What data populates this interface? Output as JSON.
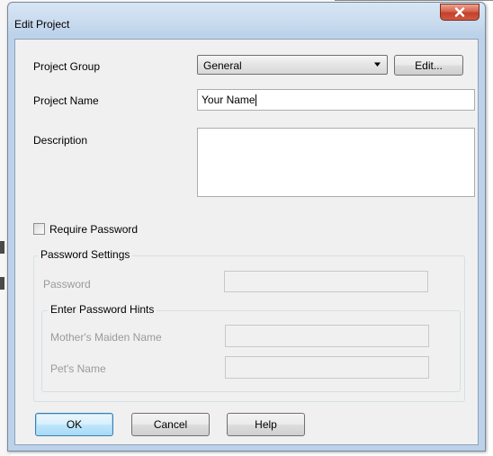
{
  "window": {
    "title": "Edit Project"
  },
  "form": {
    "project_group_label": "Project Group",
    "project_group_value": "General",
    "edit_button": "Edit...",
    "project_name_label": "Project Name",
    "project_name_value": "Your Name",
    "description_label": "Description",
    "description_value": "",
    "require_password_label": "Require Password",
    "require_password_checked": false
  },
  "password_settings": {
    "legend": "Password Settings",
    "password_label": "Password",
    "password_value": "",
    "hints": {
      "legend": "Enter Password Hints",
      "maiden_name_label": "Mother's Maiden Name",
      "maiden_name_value": "",
      "pet_name_label": "Pet's Name",
      "pet_name_value": ""
    }
  },
  "buttons": {
    "ok": "OK",
    "cancel": "Cancel",
    "help": "Help"
  },
  "icons": {
    "close": "close-icon",
    "dropdown": "chevron-down-icon"
  },
  "colors": {
    "close_button": "#c3402a",
    "default_button_border": "#3c7fb1",
    "disabled_text": "#9a9a9a"
  }
}
